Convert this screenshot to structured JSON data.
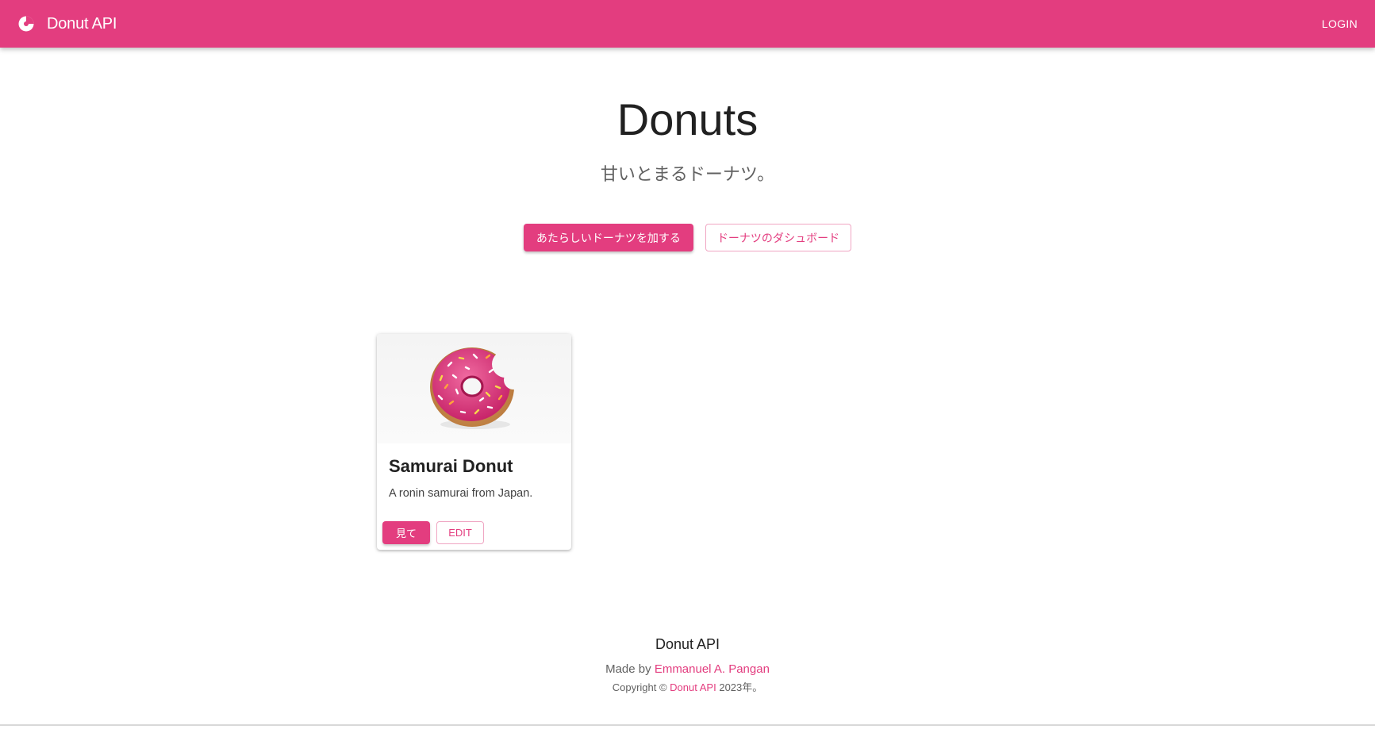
{
  "appbar": {
    "brand": "Donut API",
    "logo_icon": "donut-logo-icon",
    "login_label": "LOGIN",
    "color": "#e33d7f"
  },
  "hero": {
    "title": "Donuts",
    "subtitle": "甘いとまるドーナツ。",
    "primary_button": "あたらしいドーナツを加する",
    "secondary_button": "ドーナツのダシュボード"
  },
  "cards": [
    {
      "image": "pink-sprinkle-donut-image",
      "title": "Samurai Donut",
      "description": "A ronin samurai from Japan.",
      "view_label": "見て",
      "edit_label": "EDIT"
    }
  ],
  "footer": {
    "title": "Donut API",
    "made_by_prefix": "Made by",
    "author": "Emmanuel A. Pangan",
    "copyright_prefix": "Copyright ©",
    "copyright_link": "Donut API",
    "copyright_suffix": "2023年。"
  },
  "colors": {
    "accent": "#e33d7f",
    "outline_border": "#f0a6c3"
  }
}
